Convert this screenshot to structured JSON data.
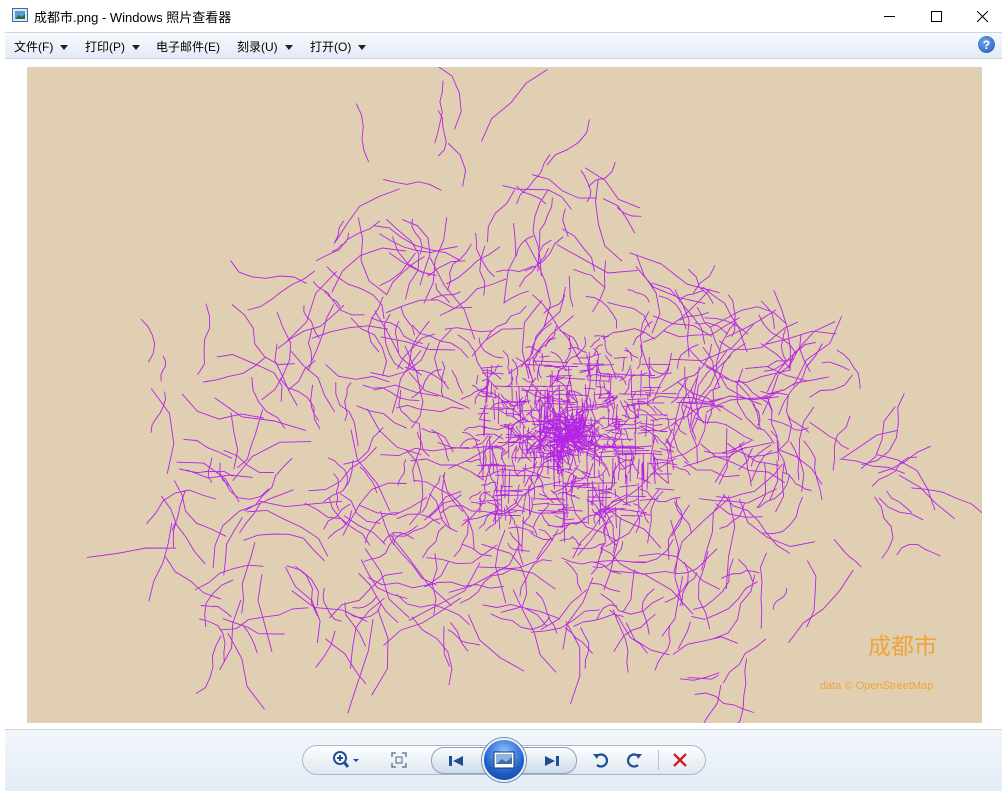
{
  "window": {
    "title": "成都市.png - Windows 照片查看器"
  },
  "menu": {
    "items": [
      {
        "label": "文件(F)",
        "has_dropdown": true
      },
      {
        "label": "打印(P)",
        "has_dropdown": true
      },
      {
        "label": "电子邮件(E)",
        "has_dropdown": false
      },
      {
        "label": "刻录(U)",
        "has_dropdown": true
      },
      {
        "label": "打开(O)",
        "has_dropdown": true
      }
    ],
    "help_label": "?"
  },
  "image": {
    "caption": "成都市",
    "credit": "data © OpenStreetMap",
    "background_color": "#e0cfb3",
    "road_color": "#b424e6",
    "caption_color": "#f0a43a"
  },
  "toolbar": {
    "icons": [
      "zoom-icon",
      "actual-size-icon",
      "previous-icon",
      "slideshow-icon",
      "next-icon",
      "rotate-counterclockwise-icon",
      "rotate-clockwise-icon",
      "delete-icon"
    ]
  }
}
